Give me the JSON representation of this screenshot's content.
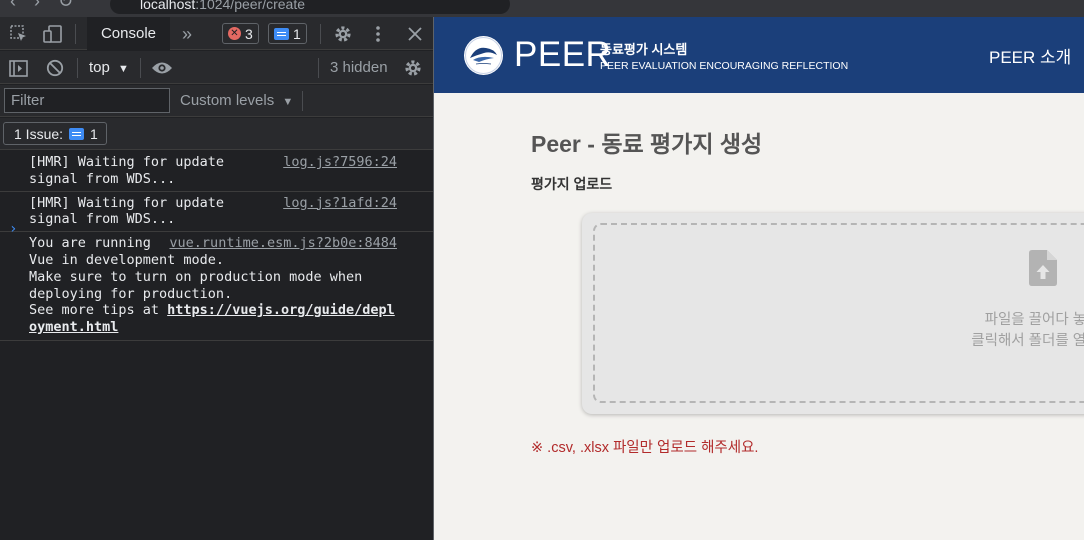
{
  "browser": {
    "url_host": "localhost",
    "url_path": ":1024/peer/create"
  },
  "devtools": {
    "active_tab": "Console",
    "error_count": "3",
    "message_count": "1",
    "context": "top",
    "hidden_count": "3 hidden",
    "filter_placeholder": "Filter",
    "levels_label": "Custom levels",
    "issues_label": "1 Issue:",
    "issues_count": "1",
    "logs": [
      {
        "message": "[HMR] Waiting for update\nsignal from WDS...",
        "source": "log.js?7596:24"
      },
      {
        "message": "[HMR] Waiting for update\nsignal from WDS...",
        "source": "log.js?1afd:24"
      }
    ],
    "vue_log": {
      "first": "You are running",
      "source": "vue.runtime.esm.js?2b0e:8484",
      "rest": "Vue in development mode.\nMake sure to turn on production mode when\ndeploying for production.\nSee more tips at ",
      "link": "https://vuejs.org/guide/depl\noyment.html"
    },
    "prompt": "›"
  },
  "app": {
    "brand": "PEER",
    "brand_ko": "동료평가 시스템",
    "brand_en": "PEER EVALUATION ENCOURAGING REFLECTION",
    "nav_about": "PEER 소개",
    "page_title": "Peer - 동료 평가지 생성",
    "section_label": "평가지 업로드",
    "drop_text_1": "파일을 끌어다 놓으",
    "drop_text_2": "클릭해서 폴더를 열어서",
    "notice": "※ .csv, .xlsx 파일만 업로드 해주세요."
  },
  "colors": {
    "header_bg": "#1b3f7a",
    "notice_red": "#b22b2b",
    "devtools_bg": "#202124"
  }
}
